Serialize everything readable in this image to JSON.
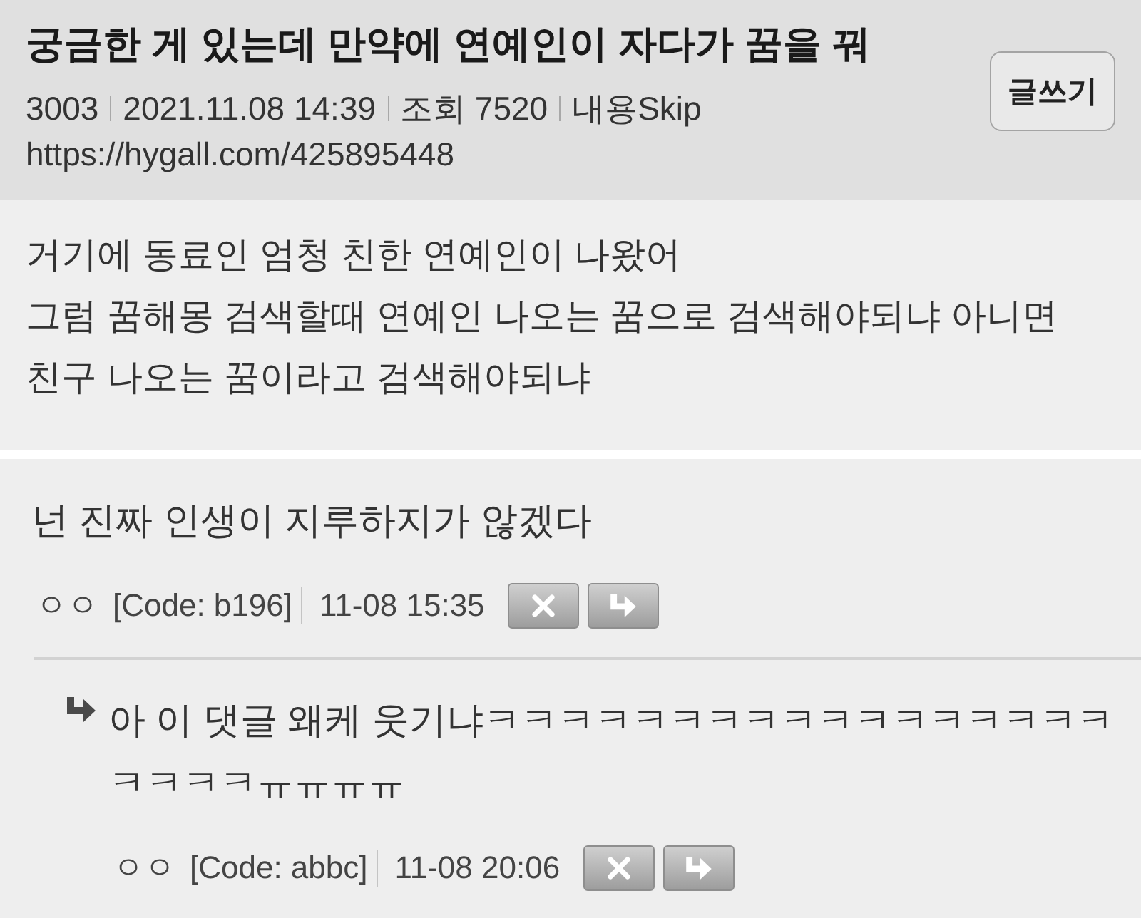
{
  "post": {
    "title": "궁금한 게 있는데 만약에 연예인이 자다가 꿈을 꿔",
    "meta": [
      "3003",
      "2021.11.08 14:39",
      "조회 7520",
      "내용Skip"
    ],
    "url": "https://hygall.com/425895448",
    "write_button": "글쓰기"
  },
  "body": {
    "paragraphs": [
      "거기에 동료인 엄청 친한 연예인이 나왔어",
      "그럼 꿈해몽 검색할때 연예인 나오는 꿈으로 검색해야되냐 아니면 친구 나오는 꿈이라고 검색해야되냐"
    ]
  },
  "comments": [
    {
      "text": "넌 진짜 인생이 지루하지가 않겠다",
      "author": "ㅇㅇ",
      "code": "[Code: b196]",
      "time": "11-08 15:35",
      "children": [
        {
          "text": "아 이 댓글 왜케 웃기냐ㅋㅋㅋㅋㅋㅋㅋㅋㅋㅋㅋㅋㅋㅋㅋㅋㅋㅋㅋㅋㅋㅠㅠㅠㅠ",
          "author": "ㅇㅇ",
          "code": "[Code: abbc]",
          "time": "11-08 20:06"
        }
      ]
    }
  ]
}
